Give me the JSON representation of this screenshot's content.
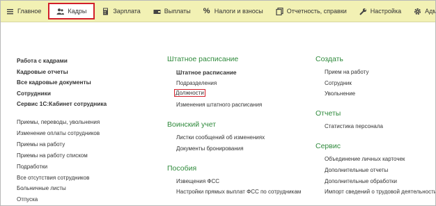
{
  "topnav": {
    "items": [
      {
        "label": "Главное",
        "icon": "menu-icon"
      },
      {
        "label": "Кадры",
        "icon": "people-icon",
        "active": true
      },
      {
        "label": "Зарплата",
        "icon": "calculator-icon"
      },
      {
        "label": "Выплаты",
        "icon": "wallet-icon"
      },
      {
        "label": "Налоги и взносы",
        "icon": "percent-icon"
      },
      {
        "label": "Отчетность, справки",
        "icon": "reports-icon"
      },
      {
        "label": "Настройка",
        "icon": "wrench-icon"
      },
      {
        "label": "Администрир",
        "icon": "gear-icon"
      }
    ],
    "active_border_color": "#d21f2a",
    "background_color": "#f2f1b4"
  },
  "left": {
    "bold_links": [
      "Работа с кадрами",
      "Кадровые отчеты",
      "Все кадровые документы",
      "Сотрудники",
      "Сервис 1С:Кабинет сотрудника"
    ],
    "links": [
      "Приемы, переводы, увольнения",
      "Изменение оплаты сотрудников",
      "Приемы на работу",
      "Приемы на работу списком",
      "Подработки",
      "Все отсутствия сотрудников",
      "Больничные листы",
      "Отпуска"
    ]
  },
  "middle": {
    "staffing": {
      "header": "Штатное расписание",
      "bold_link": "Штатное расписание",
      "links": [
        "Подразделения",
        "Должности",
        "Изменения штатного расписания"
      ]
    },
    "military": {
      "header": "Воинский учет",
      "links": [
        "Листки сообщений об изменениях",
        "Документы бронирования"
      ]
    },
    "benefits": {
      "header": "Пособия",
      "links": [
        "Извещения ФСС",
        "Настройки прямых выплат ФСС по сотрудникам"
      ]
    }
  },
  "right": {
    "create": {
      "header": "Создать",
      "links": [
        "Прием на работу",
        "Сотрудник",
        "Увольнение"
      ]
    },
    "reports": {
      "header": "Отчеты",
      "links": [
        "Статистика персонала"
      ]
    },
    "service": {
      "header": "Сервис",
      "links": [
        "Объединение личных карточек",
        "Дополнительные отчеты",
        "Дополнительные обработки",
        "Импорт сведений о трудовой деятельности"
      ]
    }
  },
  "colors": {
    "section_header": "#2f8a3c",
    "highlight_border": "#d21f2a"
  }
}
